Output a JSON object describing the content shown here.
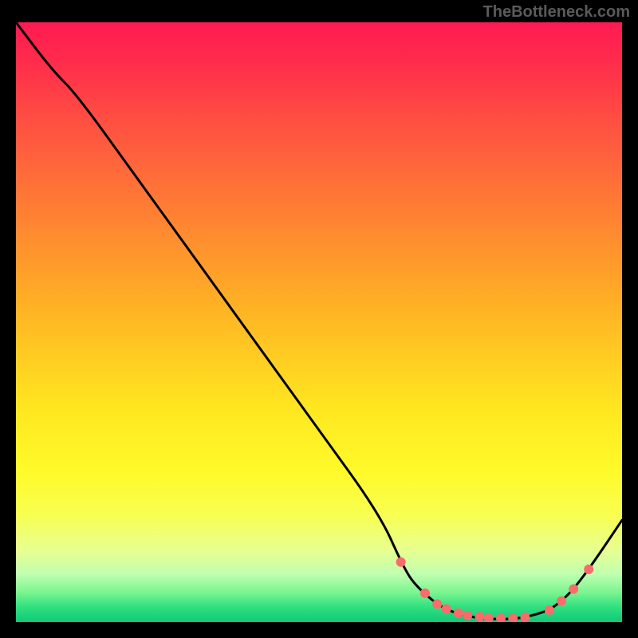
{
  "watermark": "TheBottleneck.com",
  "chart_data": {
    "type": "line",
    "title": "",
    "xlabel": "",
    "ylabel": "",
    "xlim": [
      0,
      100
    ],
    "ylim": [
      0,
      100
    ],
    "grid": false,
    "series": [
      {
        "name": "bottleneck-curve",
        "color": "#000000",
        "x": [
          0,
          6,
          10,
          20,
          30,
          40,
          50,
          60,
          64,
          66,
          70,
          74,
          78,
          82,
          85,
          88,
          90,
          92,
          95,
          100
        ],
        "values": [
          100,
          92,
          88,
          74,
          60,
          46,
          32,
          18,
          9,
          6,
          2.5,
          1,
          0.5,
          0.5,
          1,
          2,
          3.5,
          5.5,
          9.5,
          17
        ]
      }
    ],
    "markers": {
      "name": "highlight-points",
      "color": "#fa6b6b",
      "radius": 6,
      "x": [
        63.5,
        67.5,
        69.5,
        71,
        73,
        74.5,
        76.5,
        78,
        80,
        82,
        84,
        88,
        90,
        92,
        94.5
      ],
      "values": [
        10,
        4.8,
        3,
        2.2,
        1.5,
        1.1,
        0.9,
        0.7,
        0.6,
        0.6,
        0.8,
        2,
        3.5,
        5.5,
        8.8
      ]
    },
    "gradient_stops": [
      {
        "offset": 0.0,
        "color": "#ff1a52"
      },
      {
        "offset": 0.06,
        "color": "#ff2a4c"
      },
      {
        "offset": 0.15,
        "color": "#ff4a44"
      },
      {
        "offset": 0.25,
        "color": "#ff6a3a"
      },
      {
        "offset": 0.35,
        "color": "#ff8a30"
      },
      {
        "offset": 0.45,
        "color": "#ffaa26"
      },
      {
        "offset": 0.55,
        "color": "#ffca22"
      },
      {
        "offset": 0.65,
        "color": "#ffe820"
      },
      {
        "offset": 0.75,
        "color": "#fffa2a"
      },
      {
        "offset": 0.82,
        "color": "#f8ff50"
      },
      {
        "offset": 0.88,
        "color": "#e8ff90"
      },
      {
        "offset": 0.92,
        "color": "#c0ffb0"
      },
      {
        "offset": 0.95,
        "color": "#7cf590"
      },
      {
        "offset": 0.975,
        "color": "#30e080"
      },
      {
        "offset": 1.0,
        "color": "#10c878"
      }
    ]
  }
}
